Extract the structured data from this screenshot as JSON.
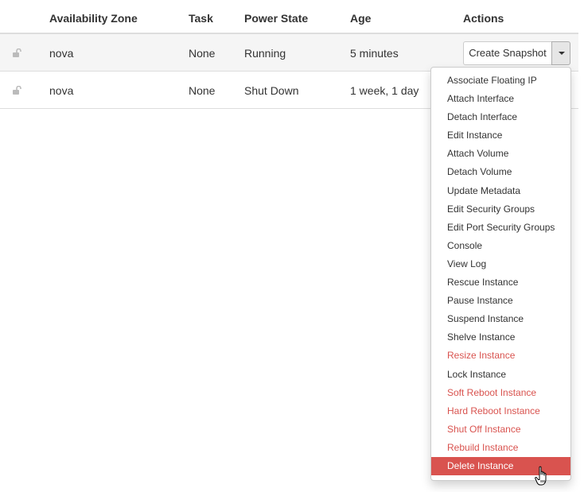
{
  "table": {
    "headers": {
      "availability_zone": "Availability Zone",
      "task": "Task",
      "power_state": "Power State",
      "age": "Age",
      "actions": "Actions"
    },
    "rows": [
      {
        "lock_icon": "unlock-icon",
        "availability_zone": "nova",
        "task": "None",
        "power_state": "Running",
        "age": "5 minutes"
      },
      {
        "lock_icon": "unlock-icon",
        "availability_zone": "nova",
        "task": "None",
        "power_state": "Shut Down",
        "age": "1 week, 1 day"
      }
    ]
  },
  "actions": {
    "primary_label": "Create Snapshot",
    "toggle_icon": "caret-down-icon"
  },
  "dropdown": {
    "items": [
      {
        "label": "Associate Floating IP",
        "style": "normal"
      },
      {
        "label": "Attach Interface",
        "style": "normal"
      },
      {
        "label": "Detach Interface",
        "style": "normal"
      },
      {
        "label": "Edit Instance",
        "style": "normal"
      },
      {
        "label": "Attach Volume",
        "style": "normal"
      },
      {
        "label": "Detach Volume",
        "style": "normal"
      },
      {
        "label": "Update Metadata",
        "style": "normal"
      },
      {
        "label": "Edit Security Groups",
        "style": "normal"
      },
      {
        "label": "Edit Port Security Groups",
        "style": "normal"
      },
      {
        "label": "Console",
        "style": "normal"
      },
      {
        "label": "View Log",
        "style": "normal"
      },
      {
        "label": "Rescue Instance",
        "style": "normal"
      },
      {
        "label": "Pause Instance",
        "style": "normal"
      },
      {
        "label": "Suspend Instance",
        "style": "normal"
      },
      {
        "label": "Shelve Instance",
        "style": "normal"
      },
      {
        "label": "Resize Instance",
        "style": "danger"
      },
      {
        "label": "Lock Instance",
        "style": "normal"
      },
      {
        "label": "Soft Reboot Instance",
        "style": "danger"
      },
      {
        "label": "Hard Reboot Instance",
        "style": "danger"
      },
      {
        "label": "Shut Off Instance",
        "style": "danger"
      },
      {
        "label": "Rebuild Instance",
        "style": "danger"
      },
      {
        "label": "Delete Instance",
        "style": "active"
      }
    ]
  },
  "colors": {
    "danger": "#d9534f",
    "text": "#333333",
    "row_highlight": "#f5f5f5",
    "border": "#dddddd"
  }
}
